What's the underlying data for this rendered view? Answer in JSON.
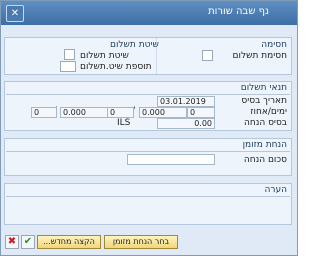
{
  "window": {
    "title": "נף שבה שורות",
    "close_glyph": "✕"
  },
  "top_section": {
    "left_header": "שיטת תשלום",
    "right_header": "חסימה",
    "items": {
      "payment_method": "שיטת תשלום",
      "payment_addition": "תוספת שיט.תשלום",
      "payment_block": "חסימת תשלום"
    }
  },
  "payment_terms": {
    "header": "תנאי תשלום",
    "baseline_date_label": "תאריך בסיס",
    "baseline_date_value": "03.01.2019",
    "days_percent_label": "ימים/אחוז",
    "days_percent_values": [
      "0",
      "0.000",
      "0",
      "0.000",
      "0"
    ],
    "discount_base_label": "בסיס הנחה",
    "discount_base_value": "0.00",
    "currency": "ILS"
  },
  "cash_discount": {
    "header": "הנחת מזומן",
    "amount_label": "סכום הנחה",
    "amount_value": ""
  },
  "note": {
    "header": "הערה"
  },
  "toolbar": {
    "select_discount": "בחר הנחת מזומן",
    "reassign": "הקצה מחדש...",
    "confirm_glyph": "✔",
    "cancel_glyph": "✖"
  },
  "colors": {
    "titlebar": "#3d6ea5",
    "dialog_bg": "#dfeaf6",
    "button": "#f0d77a"
  }
}
